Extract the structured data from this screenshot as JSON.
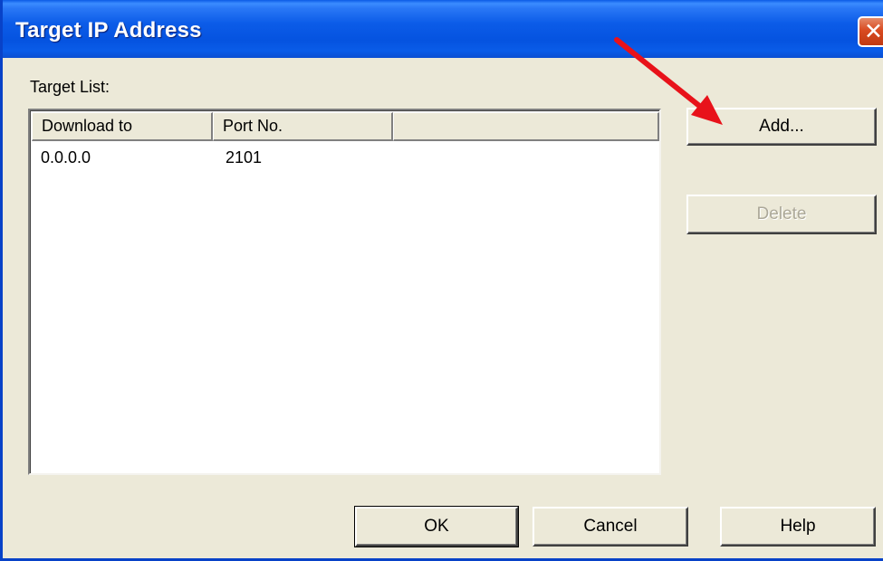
{
  "window": {
    "title": "Target IP Address",
    "close_icon": "close-icon"
  },
  "target_list": {
    "label": "Target List:",
    "columns": [
      "Download to",
      "Port No.",
      ""
    ],
    "rows": [
      {
        "download_to": "0.0.0.0",
        "port_no": "2101"
      }
    ]
  },
  "buttons": {
    "add": "Add...",
    "delete": "Delete",
    "ok": "OK",
    "cancel": "Cancel",
    "help": "Help"
  },
  "annotation": {
    "arrow_color": "#e8121a",
    "arrow_target": "Add..."
  },
  "colors": {
    "titlebar": "#0553e0",
    "dialog_bg": "#ece9d8",
    "close_button": "#d94a20",
    "disabled_text": "#aca899"
  }
}
